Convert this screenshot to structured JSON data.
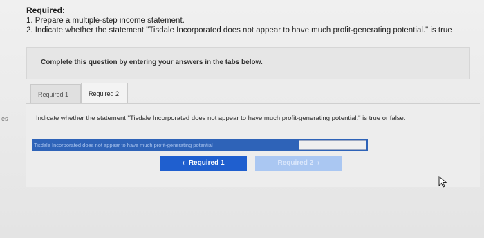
{
  "sidebar_fragment": "es",
  "requirements": {
    "title": "Required:",
    "items": [
      "1. Prepare a multiple-step income statement.",
      "2. Indicate whether the statement \"Tisdale Incorporated does not appear to have much profit-generating potential.\" is true"
    ]
  },
  "instruction": "Complete this question by entering your answers in the tabs below.",
  "tabs": [
    {
      "label": "Required 1",
      "active": false
    },
    {
      "label": "Required 2",
      "active": true
    }
  ],
  "question": "Indicate whether the statement \"Tisdale Incorporated does not appear to have much profit-generating potential.\" is true or false.",
  "answer_row": {
    "statement": "Tisdale Incorporated does not appear to have much profit-generating potential",
    "selected_value": ""
  },
  "navigation": {
    "prev_label": "Required 1",
    "prev_icon": "chevron-left-icon",
    "next_label": "Required 2",
    "next_icon": "chevron-right-icon"
  },
  "colors": {
    "accent": "#1f5fcf",
    "answer_row": "#2e63b8",
    "disabled_button": "#aac7f2"
  }
}
